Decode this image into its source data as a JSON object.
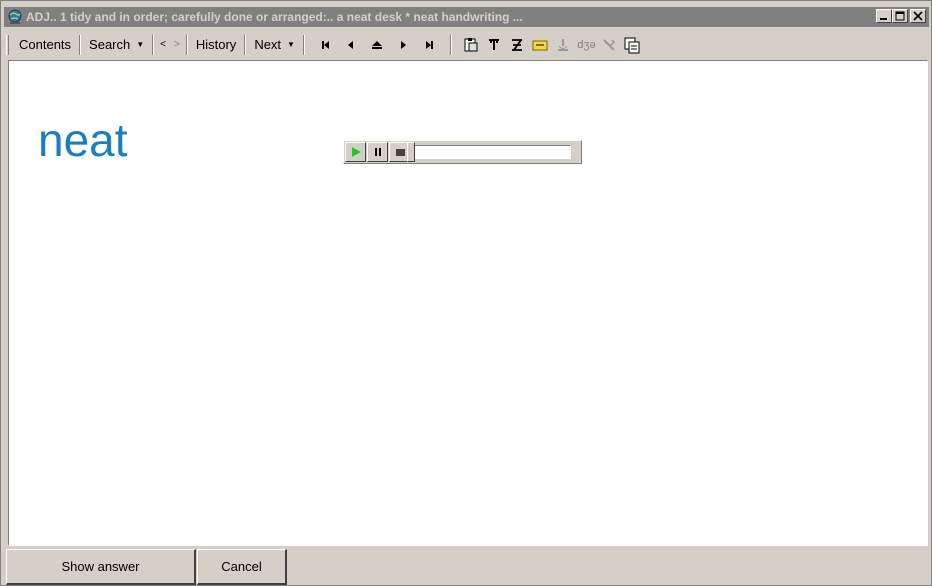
{
  "window": {
    "title": "ADJ.. 1  tidy and in order; carefully done or arranged:.. a neat desk * neat handwriting ..."
  },
  "toolbar": {
    "contents": "Contents",
    "search": "Search",
    "prev_symbol": "<",
    "next_symbol": ">",
    "history": "History",
    "next": "Next",
    "icons": [
      "first-item-icon",
      "previous-item-icon",
      "parent-item-icon",
      "next-item-icon",
      "last-item-icon",
      "paste-icon",
      "text-style-icon",
      "sigma-icon",
      "note-icon",
      "recorder-icon",
      "phonetic-icon",
      "tools-icon",
      "copy-pages-icon"
    ],
    "phonetic_label": "dʒə"
  },
  "content": {
    "word": "neat",
    "word_color": "#1a7fc0"
  },
  "player": {
    "progress": 0
  },
  "footer": {
    "show_answer": "Show answer",
    "cancel": "Cancel"
  }
}
